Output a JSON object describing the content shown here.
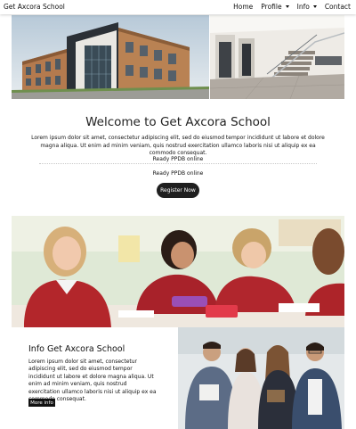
{
  "navbar": {
    "brand": "Get Axcora School",
    "items": [
      {
        "label": "Home",
        "dropdown": false
      },
      {
        "label": "Profile",
        "dropdown": true
      },
      {
        "label": "Info",
        "dropdown": true
      },
      {
        "label": "Contact",
        "dropdown": false
      }
    ]
  },
  "welcome": {
    "title": "Welcome to Get Axcora School",
    "text": "Lorem ipsum dolor sit amet, consectetur adipiscing elit, sed do eiusmod tempor incididunt ut labore et dolore magna aliqua. Ut enim ad minim veniam, quis nostrud exercitation ullamco laboris nisi ut aliquip ex ea commodo consequat.",
    "ready_line_1": "Ready PPDB online",
    "ready_line_2": "Ready PPDB online",
    "register_label": "Register Now"
  },
  "info": {
    "title": "Info Get Axcora School",
    "text": "Lorem ipsum dolor sit amet, consectetur adipiscing elit, sed do eiusmod tempor incididunt ut labore et dolore magna aliqua. Ut enim ad minim veniam, quis nostrud exercitation ullamco laboris nisi ut aliquip ex ea commodo consequat.",
    "more_label": "More info"
  },
  "colors": {
    "button_dark": "#1f1f1f",
    "text": "#111111"
  }
}
